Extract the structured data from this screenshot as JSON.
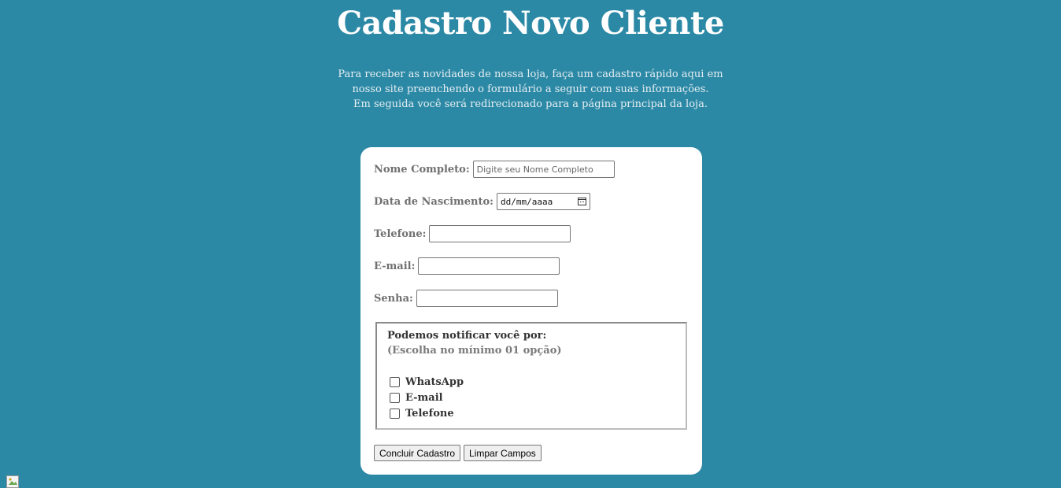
{
  "title": "Cadastro Novo Cliente",
  "intro_lines": [
    "Para receber as novidades de nossa loja, faça um cadastro rápido aqui em",
    "nosso site preenchendo o formulário a seguir com suas informações.",
    "Em seguida você será redirecionado para a página principal da loja."
  ],
  "form": {
    "name_label": "Nome Completo:",
    "name_placeholder": "Digite seu Nome Completo",
    "name_value": "",
    "birth_label": "Data de Nascimento:",
    "birth_placeholder": "dd/mm/aaaa",
    "phone_label": "Telefone:",
    "phone_value": "",
    "email_label": "E-mail:",
    "email_value": "",
    "password_label": "Senha:",
    "password_value": ""
  },
  "notify": {
    "title": "Podemos notificar você por:",
    "subtitle": "(Escolha no mínimo 01 opção)",
    "options": [
      {
        "label": "WhatsApp",
        "checked": false
      },
      {
        "label": "E-mail",
        "checked": false
      },
      {
        "label": "Telefone",
        "checked": false
      }
    ]
  },
  "buttons": {
    "submit": "Concluir Cadastro",
    "reset": "Limpar Campos"
  },
  "icons": {
    "calendar": "calendar-icon",
    "broken_image": "broken-image-icon"
  },
  "colors": {
    "background": "#2c89a6",
    "card": "#ffffff",
    "label": "#707070"
  }
}
